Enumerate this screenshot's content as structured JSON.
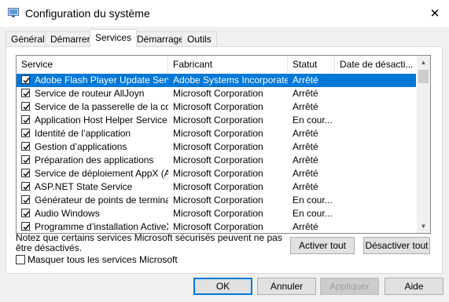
{
  "window": {
    "title": "Configuration du système"
  },
  "tabs": [
    {
      "label": "Général"
    },
    {
      "label": "Démarrer"
    },
    {
      "label": "Services",
      "active": true
    },
    {
      "label": "Démarrage"
    },
    {
      "label": "Outils"
    }
  ],
  "table": {
    "headers": [
      "Service",
      "Fabricant",
      "Statut",
      "Date de désacti..."
    ],
    "rows": [
      {
        "service": "Adobe Flash Player Update Service",
        "fabricant": "Adobe Systems Incorporated",
        "statut": "Arrêté",
        "date": "",
        "checked": true,
        "selected": true
      },
      {
        "service": "Service de routeur AllJoyn",
        "fabricant": "Microsoft Corporation",
        "statut": "Arrêté",
        "date": "",
        "checked": true
      },
      {
        "service": "Service de la passerelle de la co...",
        "fabricant": "Microsoft Corporation",
        "statut": "Arrêté",
        "date": "",
        "checked": true
      },
      {
        "service": "Application Host Helper Service",
        "fabricant": "Microsoft Corporation",
        "statut": "En cour...",
        "date": "",
        "checked": true
      },
      {
        "service": "Identité de l’application",
        "fabricant": "Microsoft Corporation",
        "statut": "Arrêté",
        "date": "",
        "checked": true
      },
      {
        "service": "Gestion d’applications",
        "fabricant": "Microsoft Corporation",
        "statut": "Arrêté",
        "date": "",
        "checked": true
      },
      {
        "service": "Préparation des applications",
        "fabricant": "Microsoft Corporation",
        "statut": "Arrêté",
        "date": "",
        "checked": true
      },
      {
        "service": "Service de déploiement AppX (A...",
        "fabricant": "Microsoft Corporation",
        "statut": "Arrêté",
        "date": "",
        "checked": true
      },
      {
        "service": "ASP.NET State Service",
        "fabricant": "Microsoft Corporation",
        "statut": "Arrêté",
        "date": "",
        "checked": true
      },
      {
        "service": "Générateur de points de termina...",
        "fabricant": "Microsoft Corporation",
        "statut": "En cour...",
        "date": "",
        "checked": true
      },
      {
        "service": "Audio Windows",
        "fabricant": "Microsoft Corporation",
        "statut": "En cour...",
        "date": "",
        "checked": true
      },
      {
        "service": "Programme d’installation ActiveX...",
        "fabricant": "Microsoft Corporation",
        "statut": "Arrêté",
        "date": "",
        "checked": true
      }
    ]
  },
  "note": "Notez que certains services Microsoft sécurisés peuvent ne pas être désactivés.",
  "buttons": {
    "enable_all": "Activer tout",
    "disable_all": "Désactiver tout",
    "ok": "OK",
    "cancel": "Annuler",
    "apply": "Appliquer",
    "help": "Aide"
  },
  "hide_ms": {
    "label": "Masquer tous les services Microsoft",
    "checked": false
  },
  "colors": {
    "selection": "#0078d7",
    "accent": "#0078d7"
  }
}
